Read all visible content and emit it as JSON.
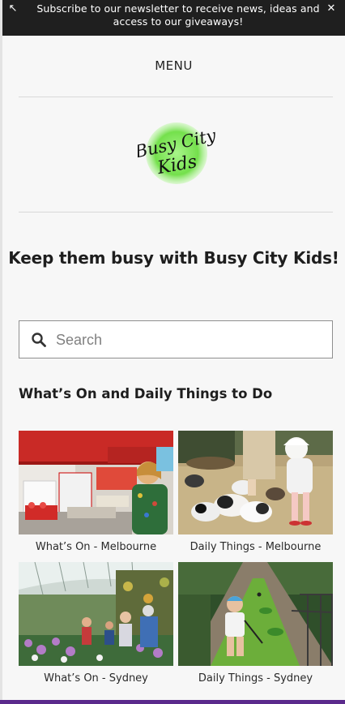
{
  "banner": {
    "message": "Subscribe to our newsletter to receive news, ideas and access to our giveaways!",
    "expand_icon": "expand-arrow-icon",
    "close_icon": "close-icon"
  },
  "nav": {
    "menu_label": "MENU"
  },
  "logo": {
    "text_line1": "Busy City",
    "text_line2": "Kids",
    "accent": "#7fe05a"
  },
  "hero": {
    "tagline": "Keep them busy with Busy City Kids!"
  },
  "search": {
    "placeholder": "Search",
    "value": "",
    "icon": "search-icon"
  },
  "section": {
    "title": "What’s On and Daily Things to Do"
  },
  "cards": [
    {
      "caption": "What’s On - Melbourne",
      "image": "child building with lego bricks"
    },
    {
      "caption": "Daily Things - Melbourne",
      "image": "child feeding rabbits"
    },
    {
      "caption": "What’s On - Sydney",
      "image": "family in flower greenhouse"
    },
    {
      "caption": "Daily Things - Sydney",
      "image": "child playing mini golf"
    }
  ],
  "colors": {
    "banner_bg": "#1f1f1f",
    "bottom_bar": "#5b2a8c"
  }
}
